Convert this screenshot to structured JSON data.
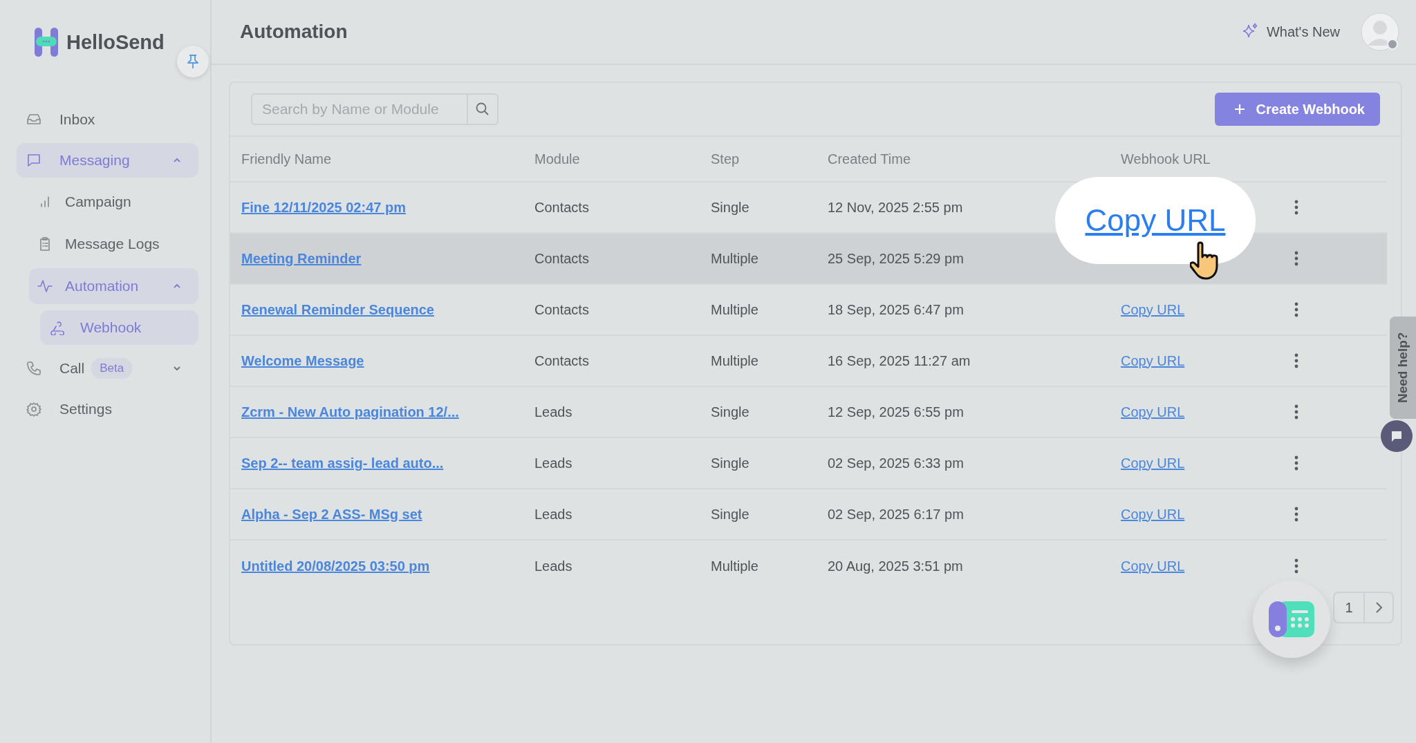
{
  "brand": {
    "name": "HelloSend"
  },
  "sidebar": {
    "items": [
      {
        "label": "Inbox",
        "selected": false
      },
      {
        "label": "Messaging",
        "selected": true,
        "expanded": true,
        "children": [
          {
            "label": "Campaign",
            "selected": false
          },
          {
            "label": "Message Logs",
            "selected": false
          },
          {
            "label": "Automation",
            "selected": true,
            "expanded": true,
            "children": [
              {
                "label": "Webhook",
                "selected": true
              }
            ]
          }
        ]
      },
      {
        "label": "Call",
        "badge": "Beta",
        "selected": false,
        "expanded": false
      },
      {
        "label": "Settings",
        "selected": false
      }
    ]
  },
  "header": {
    "title": "Automation",
    "whats_new": "What's New"
  },
  "search": {
    "placeholder": "Search by Name or Module"
  },
  "create_button": "Create Webhook",
  "table": {
    "columns": [
      "Friendly Name",
      "Module",
      "Step",
      "Created Time",
      "Webhook URL"
    ],
    "rows": [
      {
        "name": "Fine 12/11/2025 02:47 pm",
        "module": "Contacts",
        "step": "Single",
        "created": "12 Nov, 2025 2:55 pm",
        "hovered": false
      },
      {
        "name": "Meeting Reminder",
        "module": "Contacts",
        "step": "Multiple",
        "created": "25 Sep, 2025 5:29 pm",
        "hovered": true
      },
      {
        "name": "Renewal Reminder Sequence",
        "module": "Contacts",
        "step": "Multiple",
        "created": "18 Sep, 2025 6:47 pm",
        "url": "Copy URL",
        "hovered": false
      },
      {
        "name": "Welcome Message",
        "module": "Contacts",
        "step": "Multiple",
        "created": "16 Sep, 2025 11:27 am",
        "url": "Copy URL",
        "hovered": false
      },
      {
        "name": "Zcrm - New Auto pagination 12/...",
        "module": "Leads",
        "step": "Single",
        "created": "12 Sep, 2025 6:55 pm",
        "url": "Copy URL",
        "hovered": false
      },
      {
        "name": "Sep 2-- team assig- lead auto...",
        "module": "Leads",
        "step": "Single",
        "created": "02 Sep, 2025 6:33 pm",
        "url": "Copy URL",
        "hovered": false
      },
      {
        "name": "Alpha - Sep 2 ASS- MSg set",
        "module": "Leads",
        "step": "Single",
        "created": "02 Sep, 2025 6:17 pm",
        "url": "Copy URL",
        "hovered": false
      },
      {
        "name": "Untitled 20/08/2025 03:50 pm",
        "module": "Leads",
        "step": "Multiple",
        "created": "20 Aug, 2025 3:51 pm",
        "url": "Copy URL",
        "hovered": false
      }
    ]
  },
  "callout": {
    "text": "Copy URL"
  },
  "pagination": {
    "current": "1"
  },
  "help_tab": {
    "label": "Need help?"
  }
}
